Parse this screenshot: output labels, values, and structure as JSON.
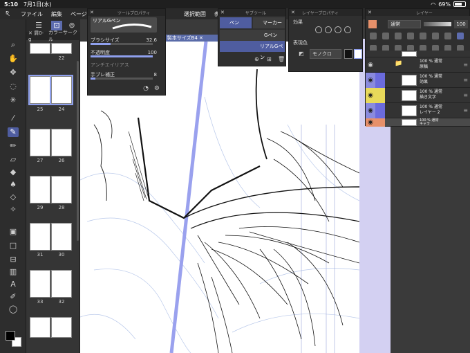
{
  "status": {
    "time": "5:10",
    "date": "7月1日(水)",
    "battery": "69%",
    "battery_level": 0.69
  },
  "menu": {
    "items": [
      "ファイル",
      "編集",
      "ページ管",
      "選択範囲",
      "表示"
    ]
  },
  "page_panel": {
    "tab_label": "✕ 屑0-g",
    "tab_label2": "カラーサークル",
    "thumbs": [
      {
        "left": "",
        "right": "22"
      },
      {
        "left": "25",
        "right": "24"
      },
      {
        "left": "27",
        "right": "26"
      },
      {
        "left": "29",
        "right": "28"
      },
      {
        "left": "31",
        "right": "30"
      },
      {
        "left": "33",
        "right": "32"
      }
    ]
  },
  "doc_tab": {
    "title": "00mm 製本サイズB4 ✕"
  },
  "tool_property": {
    "title": "ツールプロパティ",
    "brush_name": "リアルGペン",
    "brush_size_label": "ブラシサイズ",
    "brush_size": "32.6",
    "brush_size_level": 0.32,
    "opacity_label": "不透明度",
    "opacity": "100",
    "opacity_level": 1.0,
    "antialias_label": "アンチエイリアス",
    "stabilization_label": "手ブレ補正",
    "stabilization": "8",
    "stabilization_level": 0.08
  },
  "subtool": {
    "title": "サブツール",
    "tabs": [
      "ペン",
      "マーカー"
    ],
    "items": [
      "Gペン",
      "リアルGペン"
    ]
  },
  "layer_property": {
    "title": "レイヤープロパティ",
    "effect_label": "効果",
    "color_label": "表現色",
    "color_mode": "モノクロ",
    "swatch_black": "#111111",
    "swatch_white": "#ffffff"
  },
  "layer_panel": {
    "title": "レイヤー",
    "blend_mode": "通常",
    "opacity": "100",
    "layers": [
      {
        "line1": "",
        "line2": "",
        "folder": false,
        "color": "#333333",
        "thumb": true
      },
      {
        "line1": "100 % 通常",
        "line2": "原稿",
        "folder": true,
        "color": "#333333",
        "thumb": false
      },
      {
        "line1": "100 % 通常",
        "line2": "効果",
        "folder": false,
        "color": "#6b6bdd",
        "thumb": true
      },
      {
        "line1": "100 % 通常",
        "line2": "描き文字",
        "folder": false,
        "color": "#e8d95a",
        "thumb": true
      },
      {
        "line1": "100 % 通常",
        "line2": "レイヤー 2",
        "folder": false,
        "color": "#6b6bdd",
        "thumb": true
      },
      {
        "line1": "100 % 通常",
        "line2": "キャラ",
        "folder": false,
        "color": "#e7906a",
        "thumb": true
      }
    ]
  },
  "colors": {
    "accent": "#5d6cae",
    "selection": "#8fa0ee",
    "lavender_bg": "#d3d0f2"
  }
}
